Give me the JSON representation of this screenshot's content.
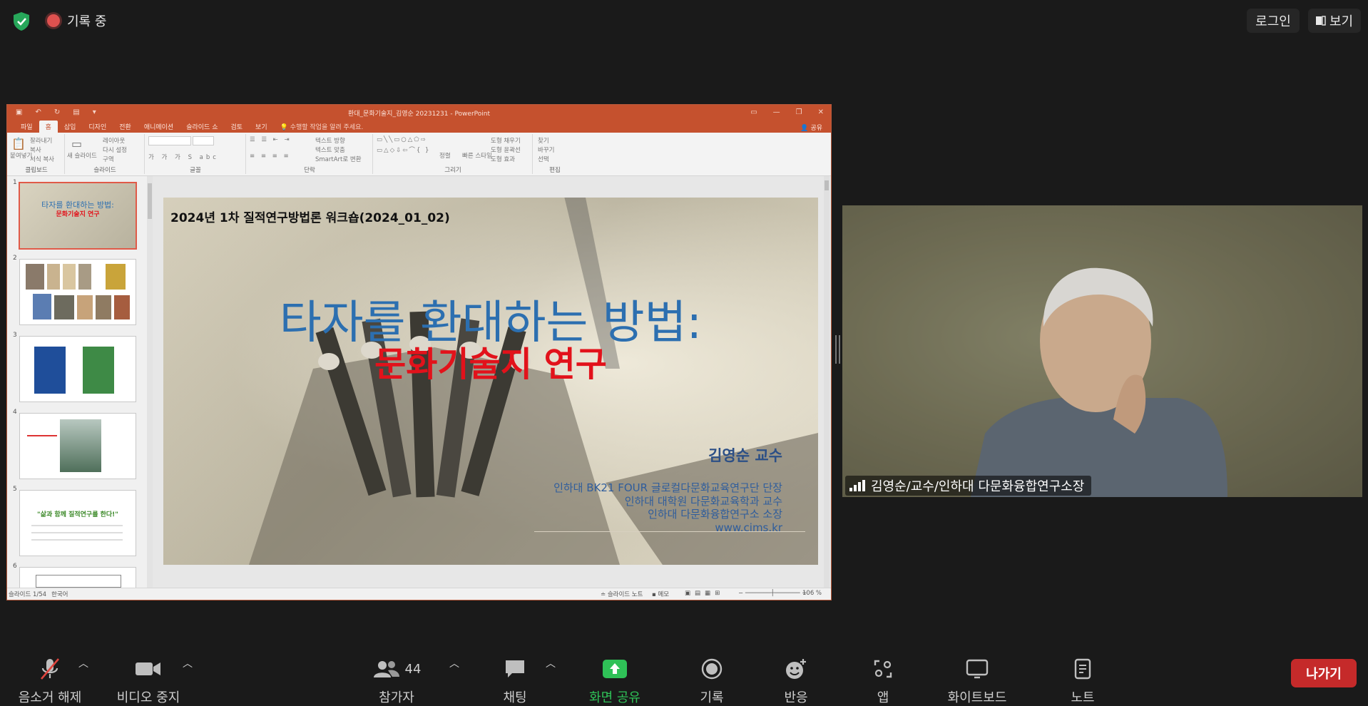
{
  "top": {
    "recording_label": "기록 중",
    "login_label": "로그인",
    "view_label": "보기"
  },
  "ppt": {
    "window_title": "환대_문화기술지_김영순 20231231 - PowerPoint",
    "tabs": [
      "파일",
      "홈",
      "삽입",
      "디자인",
      "전환",
      "애니메이션",
      "슬라이드 쇼",
      "검토",
      "보기"
    ],
    "tell_me": "수행할 작업을 알려 주세요.",
    "share": "공유",
    "ribbon": {
      "clipboard": {
        "label": "클립보드",
        "paste": "붙여넣기",
        "cut": "잘라내기",
        "copy": "복사",
        "format_painter": "서식 복사"
      },
      "slides": {
        "label": "슬라이드",
        "new_slide": "새 슬라이드",
        "layout": "레이아웃",
        "reset": "다시 설정",
        "section": "구역"
      },
      "font": {
        "label": "글꼴"
      },
      "paragraph": {
        "label": "단락",
        "text_direction": "텍스트 방향",
        "align_text": "텍스트 맞춤",
        "smartart": "SmartArt로 변환"
      },
      "drawing": {
        "label": "그리기",
        "arrange": "정렬",
        "quick_styles": "빠른 스타일",
        "fill": "도형 채우기",
        "outline": "도형 윤곽선",
        "effects": "도형 효과"
      },
      "editing": {
        "label": "편집",
        "find": "찾기",
        "replace": "바꾸기",
        "select": "선택"
      }
    },
    "thumbnails": [
      {
        "num": "1",
        "title": "타자를 환대하는 방법:",
        "title2": "문화기술지 연구"
      },
      {
        "num": "2"
      },
      {
        "num": "3"
      },
      {
        "num": "4"
      },
      {
        "num": "5",
        "title": "\"삶과 함께 질적연구를 한다!\""
      },
      {
        "num": "6"
      }
    ],
    "slide": {
      "subtitle": "2024년 1차 질적연구방법론 워크숍(2024_01_02)",
      "title_line1": "타자를 환대하는 방법:",
      "title_line2": "문화기술지 연구",
      "author": "김영순 교수",
      "affiliations": [
        "인하대 BK21 FOUR 글로컬다문화교육연구단 단장",
        "인하대 대학원 다문화교육학과 교수",
        "인하대 다문화융합연구소 소장",
        "www.cims.kr"
      ]
    },
    "status": {
      "slide_count": "슬라이드 1/54",
      "language": "한국어",
      "notes": "슬라이드 노트",
      "comments": "메모",
      "zoom": "106 %"
    }
  },
  "video": {
    "participant_name": "김영순/교수/인하대 다문화융합연구소장"
  },
  "toolbar": {
    "unmute": "음소거 해제",
    "stop_video": "비디오 중지",
    "participants": "참가자",
    "participant_count": "44",
    "chat": "채팅",
    "share_screen": "화면 공유",
    "record": "기록",
    "reactions": "반응",
    "apps": "앱",
    "whiteboard": "화이트보드",
    "notes": "노트",
    "leave": "나가기"
  },
  "colors": {
    "share_green": "#2fc157",
    "leave_red": "#c52a2a",
    "ppt_orange": "#c5512e",
    "slide_title_blue": "#2c6fb0",
    "slide_title_red": "#e2121b"
  }
}
